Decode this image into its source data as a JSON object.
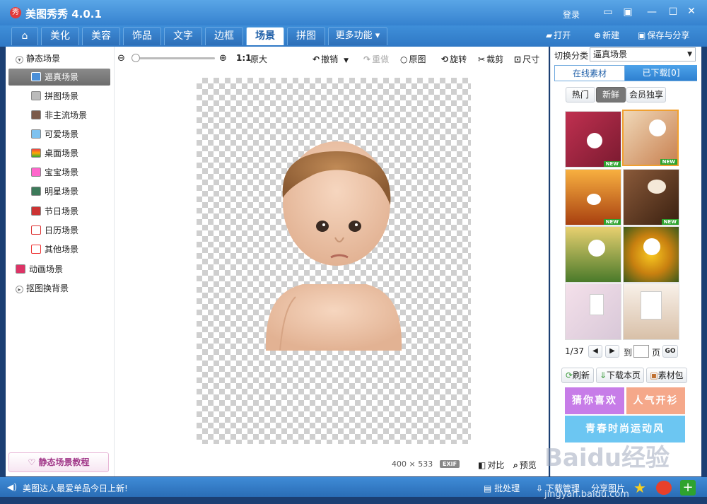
{
  "app": {
    "logo_text": "秀",
    "title": "美图秀秀 4.0.1",
    "login": "登录"
  },
  "tabs": [
    {
      "label": "美化"
    },
    {
      "label": "美容"
    },
    {
      "label": "饰品"
    },
    {
      "label": "文字"
    },
    {
      "label": "边框"
    },
    {
      "label": "场景"
    },
    {
      "label": "拼图"
    },
    {
      "label": "更多功能 ▾"
    }
  ],
  "right_tools": {
    "open": "打开",
    "new": "新建",
    "save": "保存与分享"
  },
  "left": {
    "static_group": "静态场景",
    "items": [
      "逼真场景",
      "拼图场景",
      "非主流场景",
      "可爱场景",
      "桌面场景",
      "宝宝场景",
      "明星场景",
      "节日场景",
      "日历场景",
      "其他场景"
    ],
    "anim_group": "动画场景",
    "cutout_group": "抠图换背景",
    "tutorial": "静态场景教程"
  },
  "toolbar": {
    "zoom_ratio": "1:1",
    "orig_size": "原大",
    "undo": "撤销",
    "redo": "重做",
    "original": "原图",
    "rotate": "旋转",
    "crop": "裁剪",
    "size": "尺寸"
  },
  "canvas_info": {
    "width": "400",
    "x": "×",
    "height": "533",
    "exif": "EXIF",
    "compare": "对比",
    "preview": "预览"
  },
  "right": {
    "switch_label": "切换分类",
    "switch_value": "逼真场景",
    "tab_online": "在线素材",
    "tab_downloaded": "已下载[0]",
    "filters": [
      "热门",
      "新鲜",
      "会员独享"
    ],
    "new_badge": "NEW",
    "pager": {
      "page": "1/37",
      "to": "到",
      "page_word": "页",
      "go": "GO"
    },
    "actions": {
      "refresh": "刷新",
      "download_page": "下载本页",
      "package": "素材包"
    },
    "promos": [
      "猜你喜欢",
      "人气开衫",
      "青春时尚运动风"
    ]
  },
  "status": {
    "message": "美图达人最爱单品今日上新!",
    "batch": "批处理",
    "download_mgr": "下载管理",
    "share": "分享图片"
  },
  "watermark": {
    "brand": "Baidu经验",
    "url": "jingyan.baidu.com"
  },
  "colors": {
    "title_blue": "#3582cf",
    "active_tab": "#ffffff",
    "promo_purple": "#c77ce8",
    "promo_orange": "#f5a88a",
    "promo_blue": "#6cc6f2"
  }
}
